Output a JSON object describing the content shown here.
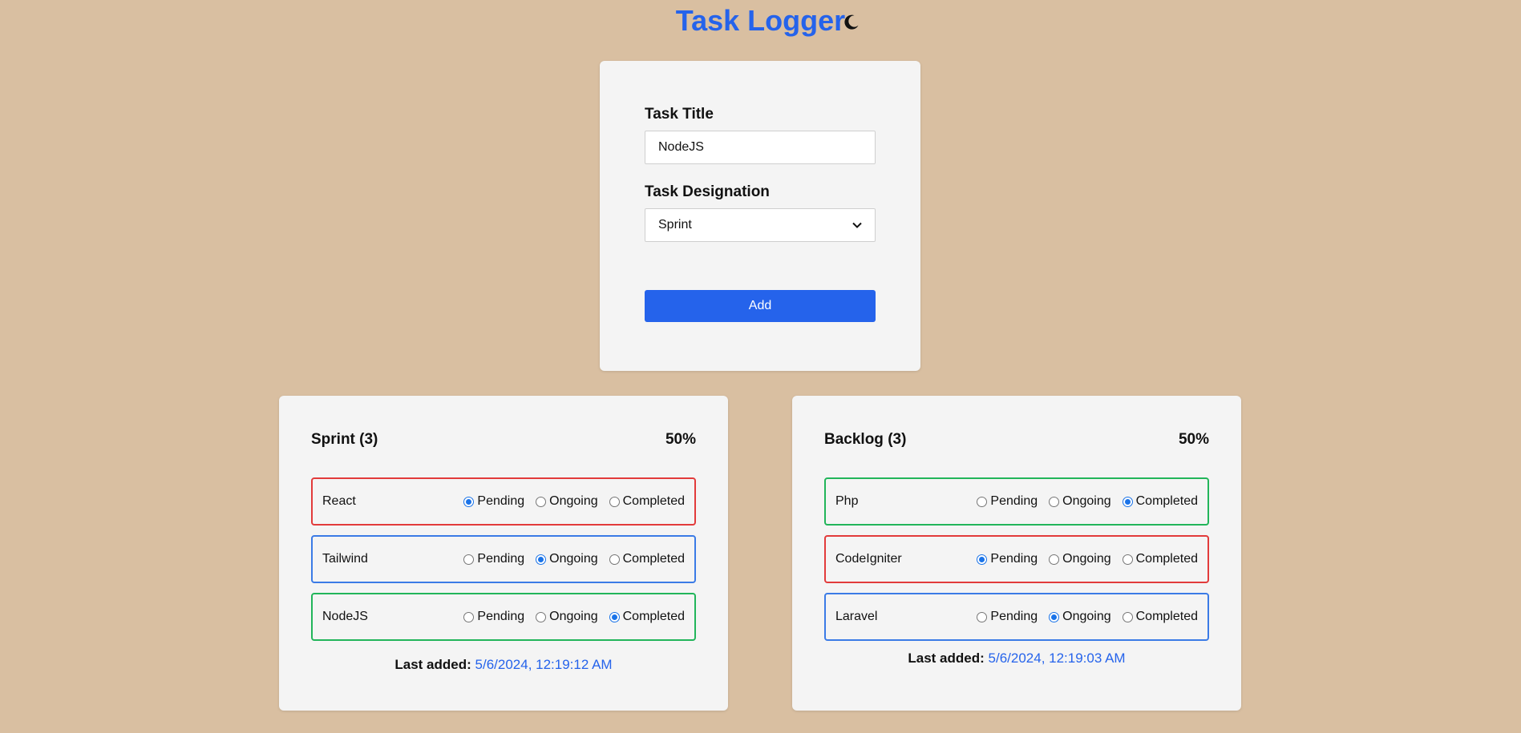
{
  "header": {
    "title": "Task Logger",
    "theme_icon": "moon-icon"
  },
  "form": {
    "title_label": "Task Title",
    "title_value": "NodeJS",
    "designation_label": "Task Designation",
    "designation_value": "Sprint",
    "add_label": "Add"
  },
  "status_labels": {
    "pending": "Pending",
    "ongoing": "Ongoing",
    "completed": "Completed"
  },
  "boards": [
    {
      "title": "Sprint (3)",
      "percent": "50%",
      "tasks": [
        {
          "name": "React",
          "status": "pending"
        },
        {
          "name": "Tailwind",
          "status": "ongoing"
        },
        {
          "name": "NodeJS",
          "status": "completed"
        }
      ],
      "last_added_label": "Last added:",
      "last_added_value": "5/6/2024, 12:19:12 AM"
    },
    {
      "title": "Backlog (3)",
      "percent": "50%",
      "tasks": [
        {
          "name": "Php",
          "status": "completed"
        },
        {
          "name": "CodeIgniter",
          "status": "pending"
        },
        {
          "name": "Laravel",
          "status": "ongoing"
        }
      ],
      "last_added_label": "Last added:",
      "last_added_value": "5/6/2024, 12:19:03 AM"
    }
  ],
  "colors": {
    "background": "#d9bfa1",
    "accent": "#2563eb",
    "pending_border": "#e23b3b",
    "ongoing_border": "#3b7be6",
    "completed_border": "#22b55a"
  }
}
